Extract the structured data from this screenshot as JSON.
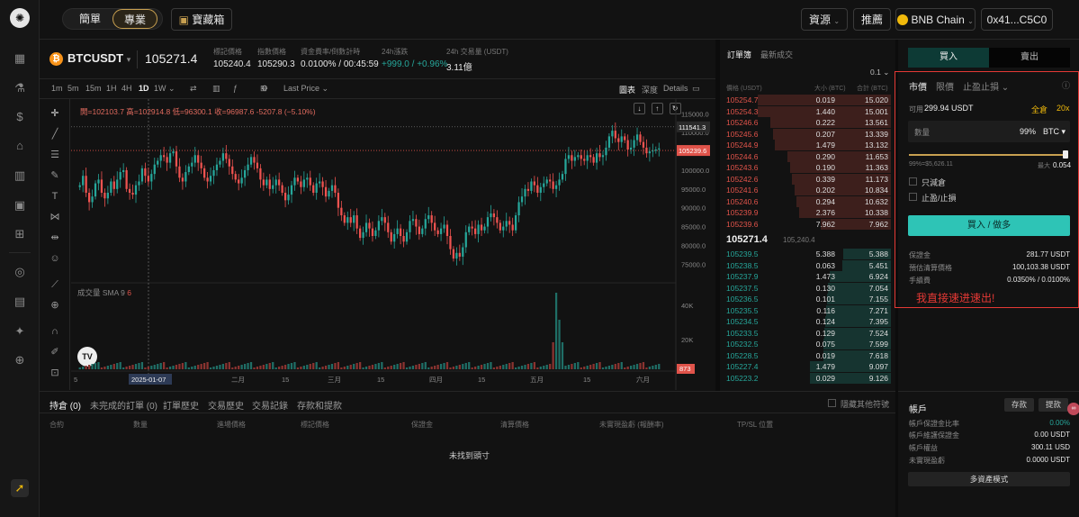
{
  "rail": {
    "icons": [
      "logo-icon",
      "chart-icon",
      "flask-icon",
      "dollar-icon",
      "bank-icon",
      "bar-chart-icon",
      "image-icon",
      "gift-icon",
      "circle-icon",
      "document-icon",
      "sparkle-icon",
      "globe-icon",
      "rocket-icon"
    ]
  },
  "topbar": {
    "mode_simple": "簡單",
    "mode_pro": "專業",
    "treasure": "寶藏箱",
    "assets": "資源",
    "referral": "推薦",
    "network": "BNB Chain",
    "wallet": "0x41...C5C0"
  },
  "symbol": {
    "pair": "BTCUSDT",
    "last": "105271.4",
    "stats": [
      {
        "label": "標記價格",
        "value": "105240.4"
      },
      {
        "label": "指數價格",
        "value": "105290.3"
      },
      {
        "label": "資金費率/倒數計時",
        "value": "0.0100% / 00:45:59"
      },
      {
        "label": "24h漲跌",
        "value": "+999.0 / +0.96%"
      },
      {
        "label": "24h 交易量 (USDT)",
        "value": "3.11億"
      }
    ]
  },
  "chart_tools": {
    "timeframes": [
      "1m",
      "5m",
      "15m",
      "1H",
      "4H",
      "1D",
      "1W"
    ],
    "active": "1D",
    "price_type": "Last Price",
    "views": [
      "圖表",
      "深度",
      "Details"
    ],
    "ohlc": "開=102103.7 高=102914.8 低=96300.1 收=96987.6 -5207.8 (−5.10%)",
    "volume_label": "成交量 SMA 9",
    "volume_val": "6",
    "date_marker": "2025-01-07"
  },
  "chart_data": {
    "type": "candlestick",
    "price_axis": [
      "115000.0",
      "110000.0",
      "105000.0",
      "100000.0",
      "95000.0",
      "90000.0",
      "85000.0",
      "80000.0",
      "75000.0"
    ],
    "price_range": [
      71000,
      117000
    ],
    "price_tags": [
      {
        "value": "111541.3",
        "color": "#2a2a2a"
      },
      {
        "value": "105239.6",
        "color": "#e0534a"
      }
    ],
    "vol_axis": [
      "40K",
      "20K"
    ],
    "vol_tag": "873",
    "x_ticks": [
      "5",
      "20",
      "二月",
      "15",
      "三月",
      "15",
      "四月",
      "15",
      "五月",
      "15",
      "六月"
    ],
    "closes": [
      96000,
      98500,
      94000,
      91500,
      93000,
      96500,
      97500,
      94000,
      92500,
      94000,
      97000,
      95000,
      97500,
      99500,
      100000,
      95000,
      94000,
      93500,
      96000,
      97000,
      100500,
      98500,
      97000,
      99000,
      101500,
      102500,
      104000,
      103500,
      102000,
      104500,
      105000,
      101000,
      98000,
      97000,
      99500,
      101000,
      102000,
      104000,
      102000,
      100500,
      98000,
      97000,
      98500,
      100000,
      101500,
      102500,
      104500,
      103000,
      101000,
      99000,
      97500,
      96500,
      98000,
      100000,
      101500,
      103500,
      102000,
      100500,
      97500,
      96000,
      97500,
      95000,
      96000,
      97500,
      96000,
      94000,
      92000,
      93500,
      96000,
      98000,
      97000,
      95500,
      97500,
      98000,
      96000,
      94000,
      96500,
      97000,
      95500,
      93000,
      94500,
      96000,
      94000,
      90000,
      88000,
      86000,
      87500,
      86000,
      88000,
      84500,
      82000,
      83500,
      86000,
      84500,
      82500,
      84000,
      86500,
      87500,
      86000,
      83500,
      81000,
      83000,
      84500,
      82500,
      81000,
      83500,
      86500,
      87000,
      85000,
      83000,
      84500,
      87000,
      88000,
      86000,
      84000,
      83000,
      84500,
      85500,
      82500,
      79000,
      76500,
      78000,
      77000,
      79500,
      83500,
      85000,
      84500,
      83000,
      85500,
      84000,
      85000,
      87500,
      88500,
      87500,
      86000,
      84000,
      85000,
      86500,
      85500,
      84000,
      88000,
      91500,
      93000,
      95000,
      94500,
      97000,
      96000,
      94000,
      95500,
      96500,
      97500,
      97000,
      95000,
      96000,
      97500,
      99000,
      103000,
      104000,
      102500,
      103500,
      104000,
      103000,
      102500,
      104000,
      103500,
      102000,
      104500,
      103500,
      104000,
      106000,
      109000,
      110500,
      108500,
      107500,
      109000,
      108000,
      105500,
      106000,
      108000,
      109500,
      107500,
      106000,
      104500,
      105000,
      105200,
      105500,
      105800
    ],
    "volume_spike_index": [
      152,
      153,
      154,
      155
    ]
  },
  "orderbook": {
    "tab_book": "訂單簿",
    "tab_trades": "最新成交",
    "step": "0.1",
    "col_price": "價格 (USDT)",
    "col_size": "大小 (BTC)",
    "col_total": "合計 (BTC)",
    "asks": [
      [
        "105254.7",
        "0.019",
        "15.020"
      ],
      [
        "105254.3",
        "1.440",
        "15.001"
      ],
      [
        "105246.6",
        "0.222",
        "13.561"
      ],
      [
        "105245.6",
        "0.207",
        "13.339"
      ],
      [
        "105244.9",
        "1.479",
        "13.132"
      ],
      [
        "105244.6",
        "0.290",
        "11.653"
      ],
      [
        "105243.6",
        "0.190",
        "11.363"
      ],
      [
        "105242.6",
        "0.339",
        "11.173"
      ],
      [
        "105241.6",
        "0.202",
        "10.834"
      ],
      [
        "105240.6",
        "0.294",
        "10.632"
      ],
      [
        "105239.9",
        "2.376",
        "10.338"
      ],
      [
        "105239.6",
        "7.962",
        "7.962"
      ]
    ],
    "mid": "105271.4",
    "mid_mark": "105,240.4",
    "bids": [
      [
        "105239.5",
        "5.388",
        "5.388"
      ],
      [
        "105238.5",
        "0.063",
        "5.451"
      ],
      [
        "105237.9",
        "1.473",
        "6.924"
      ],
      [
        "105237.5",
        "0.130",
        "7.054"
      ],
      [
        "105236.5",
        "0.101",
        "7.155"
      ],
      [
        "105235.5",
        "0.116",
        "7.271"
      ],
      [
        "105234.5",
        "0.124",
        "7.395"
      ],
      [
        "105233.5",
        "0.129",
        "7.524"
      ],
      [
        "105232.5",
        "0.075",
        "7.599"
      ],
      [
        "105228.5",
        "0.019",
        "7.618"
      ],
      [
        "105227.4",
        "1.479",
        "9.097"
      ],
      [
        "105223.2",
        "0.029",
        "9.126"
      ]
    ]
  },
  "trade": {
    "buy": "買入",
    "sell": "賣出",
    "order_types": [
      "市價",
      "限價",
      "止盈止損"
    ],
    "available_label": "可用",
    "available": "299.94 USDT",
    "margin_mode": "全倉",
    "leverage": "20x",
    "qty_label": "數量",
    "qty_pct": "99%",
    "qty_unit": "BTC",
    "slider_left": "99%=$5,626.11",
    "slider_max_label": "最大",
    "slider_max": "0.054",
    "reduce_only": "只減倉",
    "tpsl": "止盈/止損",
    "submit": "買入 / 做多",
    "info": [
      [
        "保證金",
        "281.77 USDT"
      ],
      [
        "預估清算價格",
        "100,103.38 USDT"
      ],
      [
        "手續費",
        "0.0350% / 0.0100%"
      ]
    ],
    "annotation": "我直接速进速出!"
  },
  "bottom": {
    "tabs": [
      "持倉 (0)",
      "未完成的訂單 (0)",
      "訂單歷史",
      "交易歷史",
      "交易記錄",
      "存款和提款"
    ],
    "hide_others": "隱藏其他符號",
    "columns": [
      "合約",
      "數量",
      "進場價格",
      "標記價格",
      "保證金",
      "清算價格",
      "未實現盈虧 (報酬率)",
      "TP/SL 位置"
    ],
    "empty": "未找到頭寸"
  },
  "account": {
    "title": "帳戶",
    "deposit": "存款",
    "withdraw": "提款",
    "rows": [
      [
        "帳戶保證金比率",
        "0.00%"
      ],
      [
        "帳戶維護保證金",
        "0.00 USDT"
      ],
      [
        "帳戶權益",
        "300.11 USD"
      ],
      [
        "未實現盈虧",
        "0.0000 USDT"
      ]
    ],
    "multi_asset": "多資產模式"
  },
  "colors": {
    "up": "#26a69a",
    "down": "#ef5350",
    "accent": "#2ec4b6",
    "gold": "#f0b90b",
    "annotation": "#e53935"
  }
}
